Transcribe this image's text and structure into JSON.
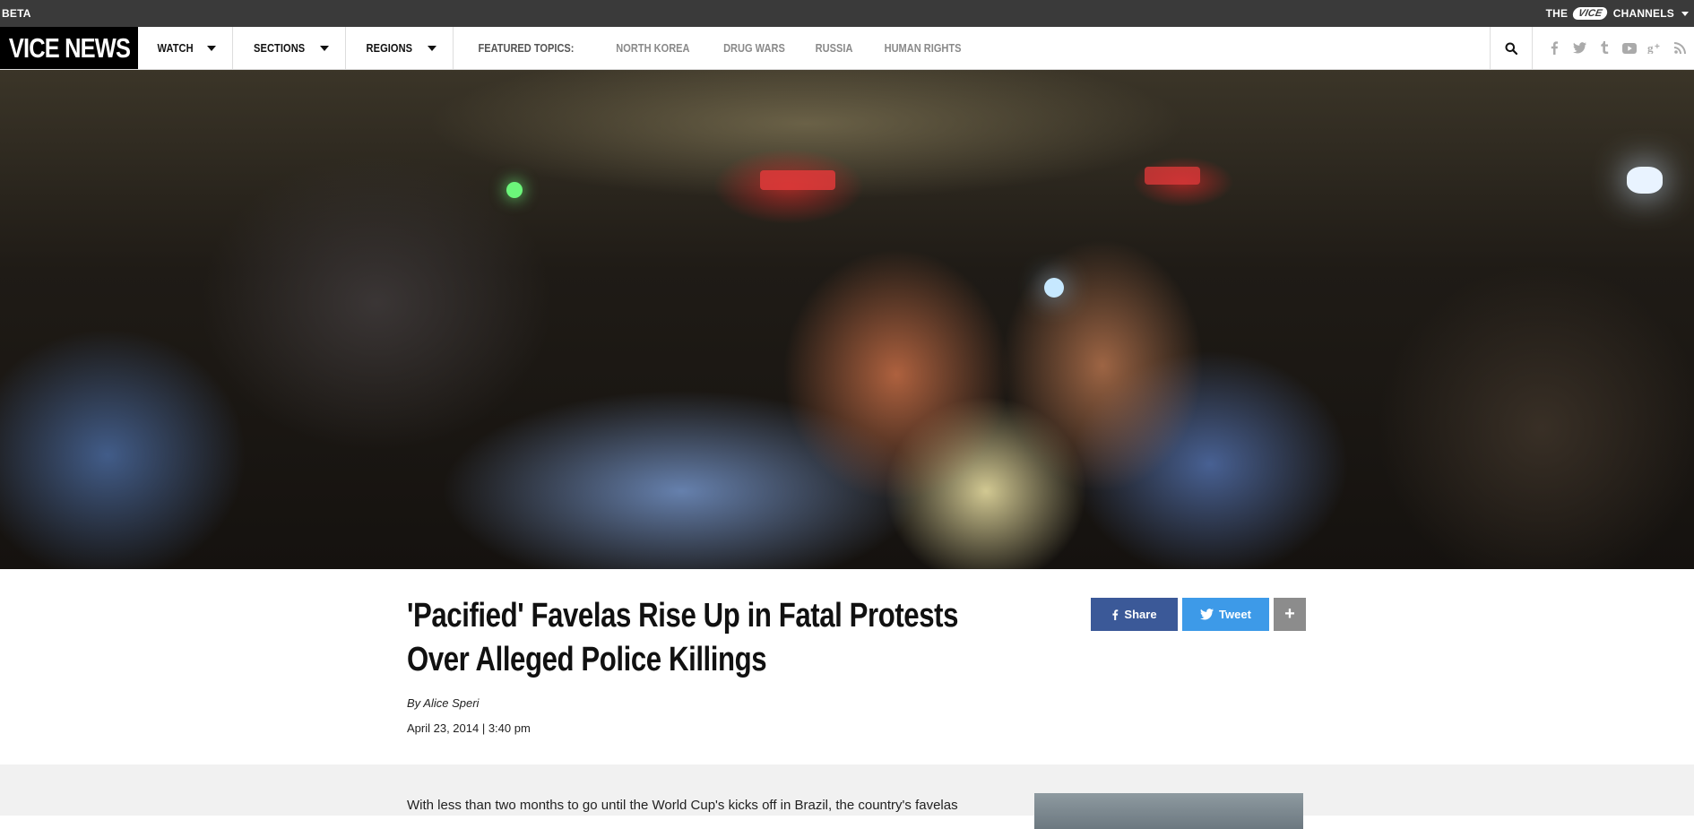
{
  "topbar": {
    "beta_label": "BETA",
    "the_label": "THE",
    "vice_label": "VICE",
    "channels_label": "CHANNELS"
  },
  "nav": {
    "logo": "VICE NEWS",
    "menus": [
      {
        "label": "WATCH"
      },
      {
        "label": "SECTIONS"
      },
      {
        "label": "REGIONS"
      }
    ],
    "featured_label": "FEATURED TOPICS:",
    "topics": [
      "NORTH KOREA",
      "DRUG WARS",
      "RUSSIA",
      "HUMAN RIGHTS"
    ],
    "social_icons": [
      "facebook-icon",
      "twitter-icon",
      "tumblr-icon",
      "youtube-icon",
      "google-plus-icon",
      "rss-icon"
    ]
  },
  "hero": {
    "image_alt": "Protester shouting at police officers at night in a crowded street"
  },
  "article": {
    "title": "'Pacified' Favelas Rise Up in Fatal Protests Over Alleged Police Killings",
    "byline": "By Alice Speri",
    "date": "April 23, 2014 | 3:40 pm",
    "share_label": "Share",
    "tweet_label": "Tweet",
    "more_label": "+",
    "body_first_line": "With less than two months to go until the World Cup's kicks off in Brazil, the country's favelas"
  },
  "colors": {
    "topbar_bg": "#3a3a3a",
    "facebook": "#3b5998",
    "twitter": "#3d9ae8",
    "more": "#8c8c8c"
  }
}
